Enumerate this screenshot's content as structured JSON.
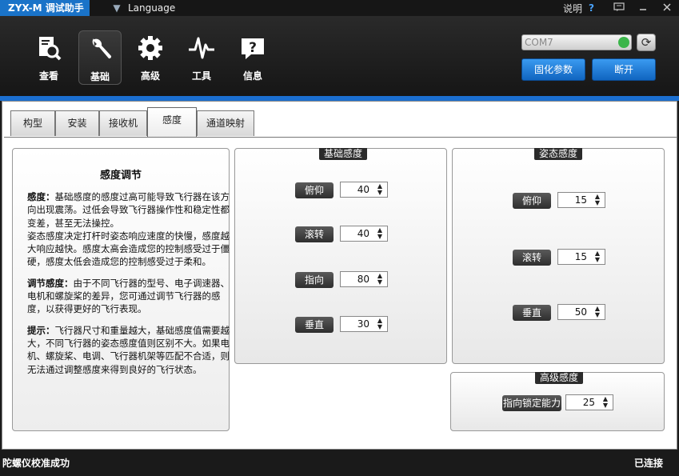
{
  "titlebar": {
    "app_title": "ZYX-M 调试助手",
    "language": "Language",
    "help": "说明",
    "help_icon": "?"
  },
  "toolbar": {
    "items": [
      {
        "label": "查看",
        "icon": "view-icon"
      },
      {
        "label": "基础",
        "icon": "wrench-icon"
      },
      {
        "label": "高级",
        "icon": "gear-icon"
      },
      {
        "label": "工具",
        "icon": "waveform-icon"
      },
      {
        "label": "信息",
        "icon": "info-bubble-icon"
      }
    ],
    "active_index": 1,
    "com_port": "COM7",
    "fix_params_label": "固化参数",
    "disconnect_label": "断开"
  },
  "tabs": [
    {
      "label": "构型"
    },
    {
      "label": "安装"
    },
    {
      "label": "接收机"
    },
    {
      "label": "感度"
    },
    {
      "label": "通道映射"
    }
  ],
  "active_tab": 3,
  "info_panel": {
    "title": "感度调节",
    "p1_head": "感度：",
    "p1_body": "基础感度的感度过高可能导致飞行器在该方向出现震荡。过低会导致飞行器操作性和稳定性都变差，甚至无法操控。",
    "p1_more": "姿态感度决定打杆时姿态响应速度的快慢，感度越大响应越快。感度太高会造成您的控制感受过于僵硬，感度太低会造成您的控制感受过于柔和。",
    "p2_head": "调节感度：",
    "p2_body": "由于不同飞行器的型号、电子调速器、电机和螺旋桨的差异，您可通过调节飞行器的感度，以获得更好的飞行表现。",
    "p3_head": "提示：",
    "p3_body": "飞行器尺寸和重量越大，基础感度值需要越大，不同飞行器的姿态感度值则区别不大。如果电机、螺旋桨、电调、飞行器机架等匹配不合适，则无法通过调整感度来得到良好的飞行状态。"
  },
  "basic_gain": {
    "title": "基础感度",
    "pitch_label": "俯仰",
    "pitch": "40",
    "roll_label": "滚转",
    "roll": "40",
    "yaw_label": "指向",
    "yaw": "80",
    "vertical_label": "垂直",
    "vertical": "30"
  },
  "attitude_gain": {
    "title": "姿态感度",
    "pitch_label": "俯仰",
    "pitch": "15",
    "roll_label": "滚转",
    "roll": "15",
    "vertical_label": "垂直",
    "vertical": "50"
  },
  "advanced_gain": {
    "title": "高级感度",
    "heading_lock_label": "指向锁定能力",
    "heading_lock": "25"
  },
  "status": {
    "left": "陀螺仪校准成功",
    "right": "已连接"
  },
  "colors": {
    "accent_blue": "#1b6fd0",
    "connected_green": "#3bb54a"
  }
}
